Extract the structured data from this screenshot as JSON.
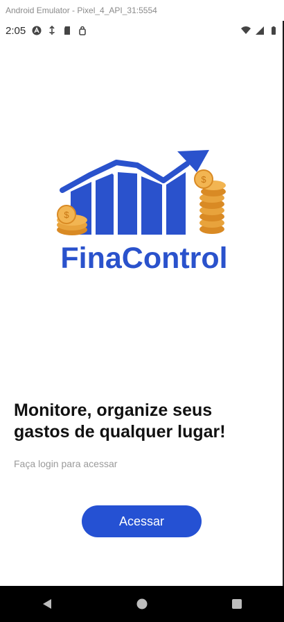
{
  "window": {
    "title": "Android Emulator - Pixel_4_API_31:5554"
  },
  "status_bar": {
    "time": "2:05",
    "icons": [
      "assistant-icon",
      "sync-icon",
      "sd-card-icon",
      "security-icon"
    ],
    "right_icons": [
      "wifi-icon",
      "signal-icon",
      "battery-icon"
    ]
  },
  "logo": {
    "brand_text": "FinaControl",
    "colors": {
      "blue": "#2A52CC",
      "coin": "#E8A33C"
    }
  },
  "main": {
    "headline": "Monitore, organize seus gastos de qualquer lugar!",
    "subtitle": "Faça login para acessar",
    "button_label": "Acessar"
  },
  "nav_bar": {
    "items": [
      "back-icon",
      "home-icon",
      "overview-icon"
    ]
  },
  "colors": {
    "accent": "#2551D3",
    "nav_bar": "#000000"
  }
}
